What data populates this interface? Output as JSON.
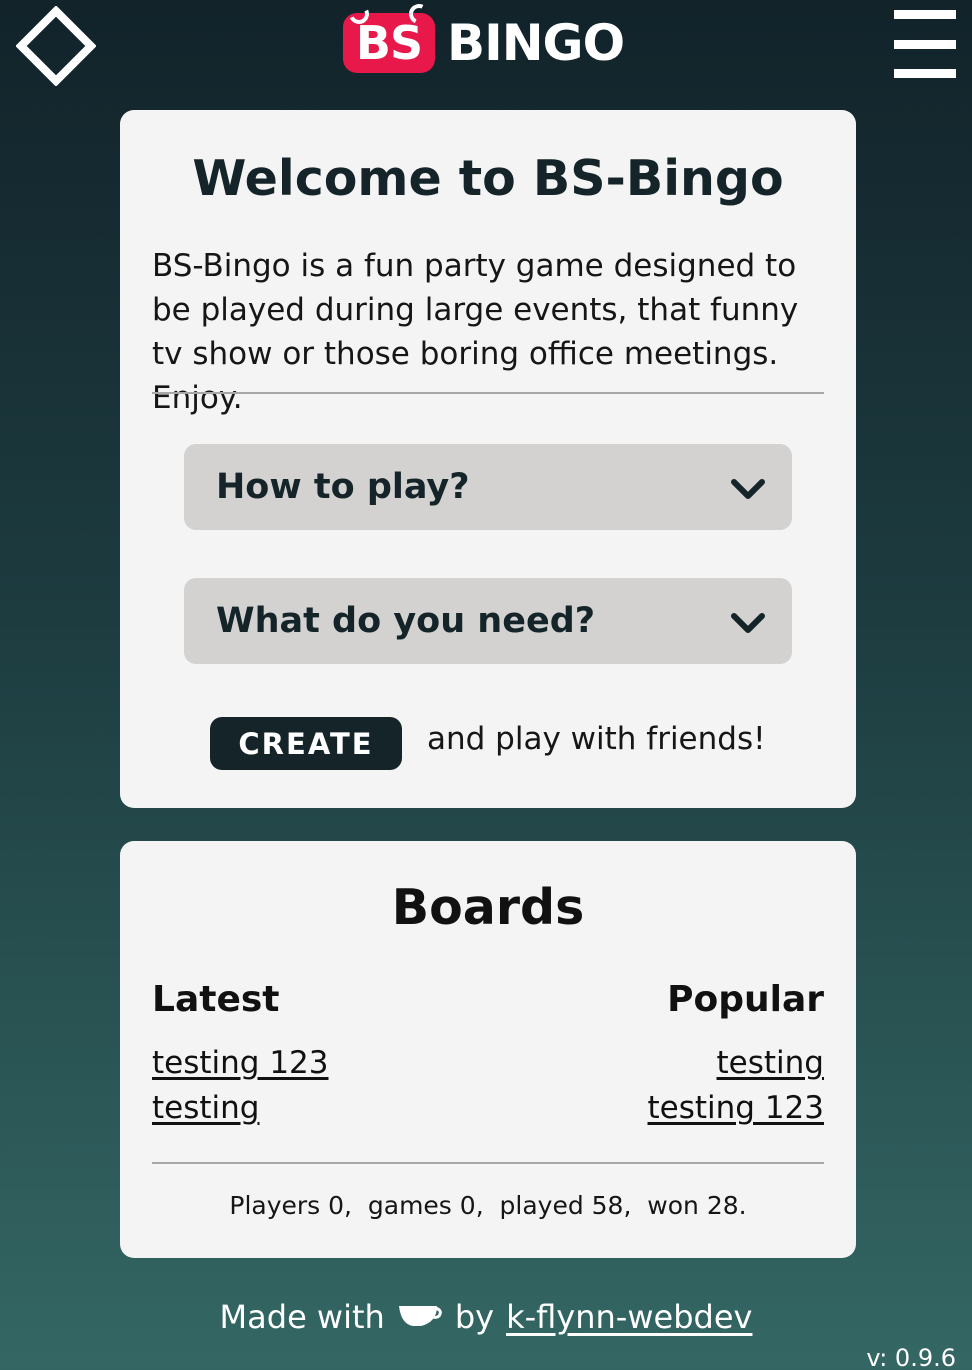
{
  "header": {
    "home_icon": "diamond-outline-icon",
    "menu_icon": "hamburger-menu-icon",
    "logo_badge": "BS",
    "logo_word": "BINGO",
    "colors": {
      "badge": "#e8184a",
      "icon": "#ffffff"
    }
  },
  "welcome": {
    "title": "Welcome to BS-Bingo",
    "description": "BS-Bingo is a fun party game designed to be played during large events, that funny tv show or those boring office meetings. Enjoy.",
    "accordions": [
      {
        "label": "How to play?",
        "icon": "chevron-down-icon"
      },
      {
        "label": "What do you need?",
        "icon": "chevron-down-icon"
      }
    ],
    "create_label": "CREATE",
    "create_note": "and play with friends!",
    "colors": {
      "accent": "#142429",
      "accordion_bg": "#d3d2d0"
    }
  },
  "boards": {
    "title": "Boards",
    "latest_label": "Latest",
    "popular_label": "Popular",
    "latest": [
      "testing 123",
      "testing"
    ],
    "popular": [
      "testing",
      "testing 123"
    ],
    "stats": "Players 0,  games 0,  played 58,  won 28."
  },
  "footer": {
    "made_with": "Made with",
    "icon": "coffee-cup-icon",
    "by": "by",
    "author": "k-flynn-webdev",
    "version": "v: 0.9.6"
  }
}
